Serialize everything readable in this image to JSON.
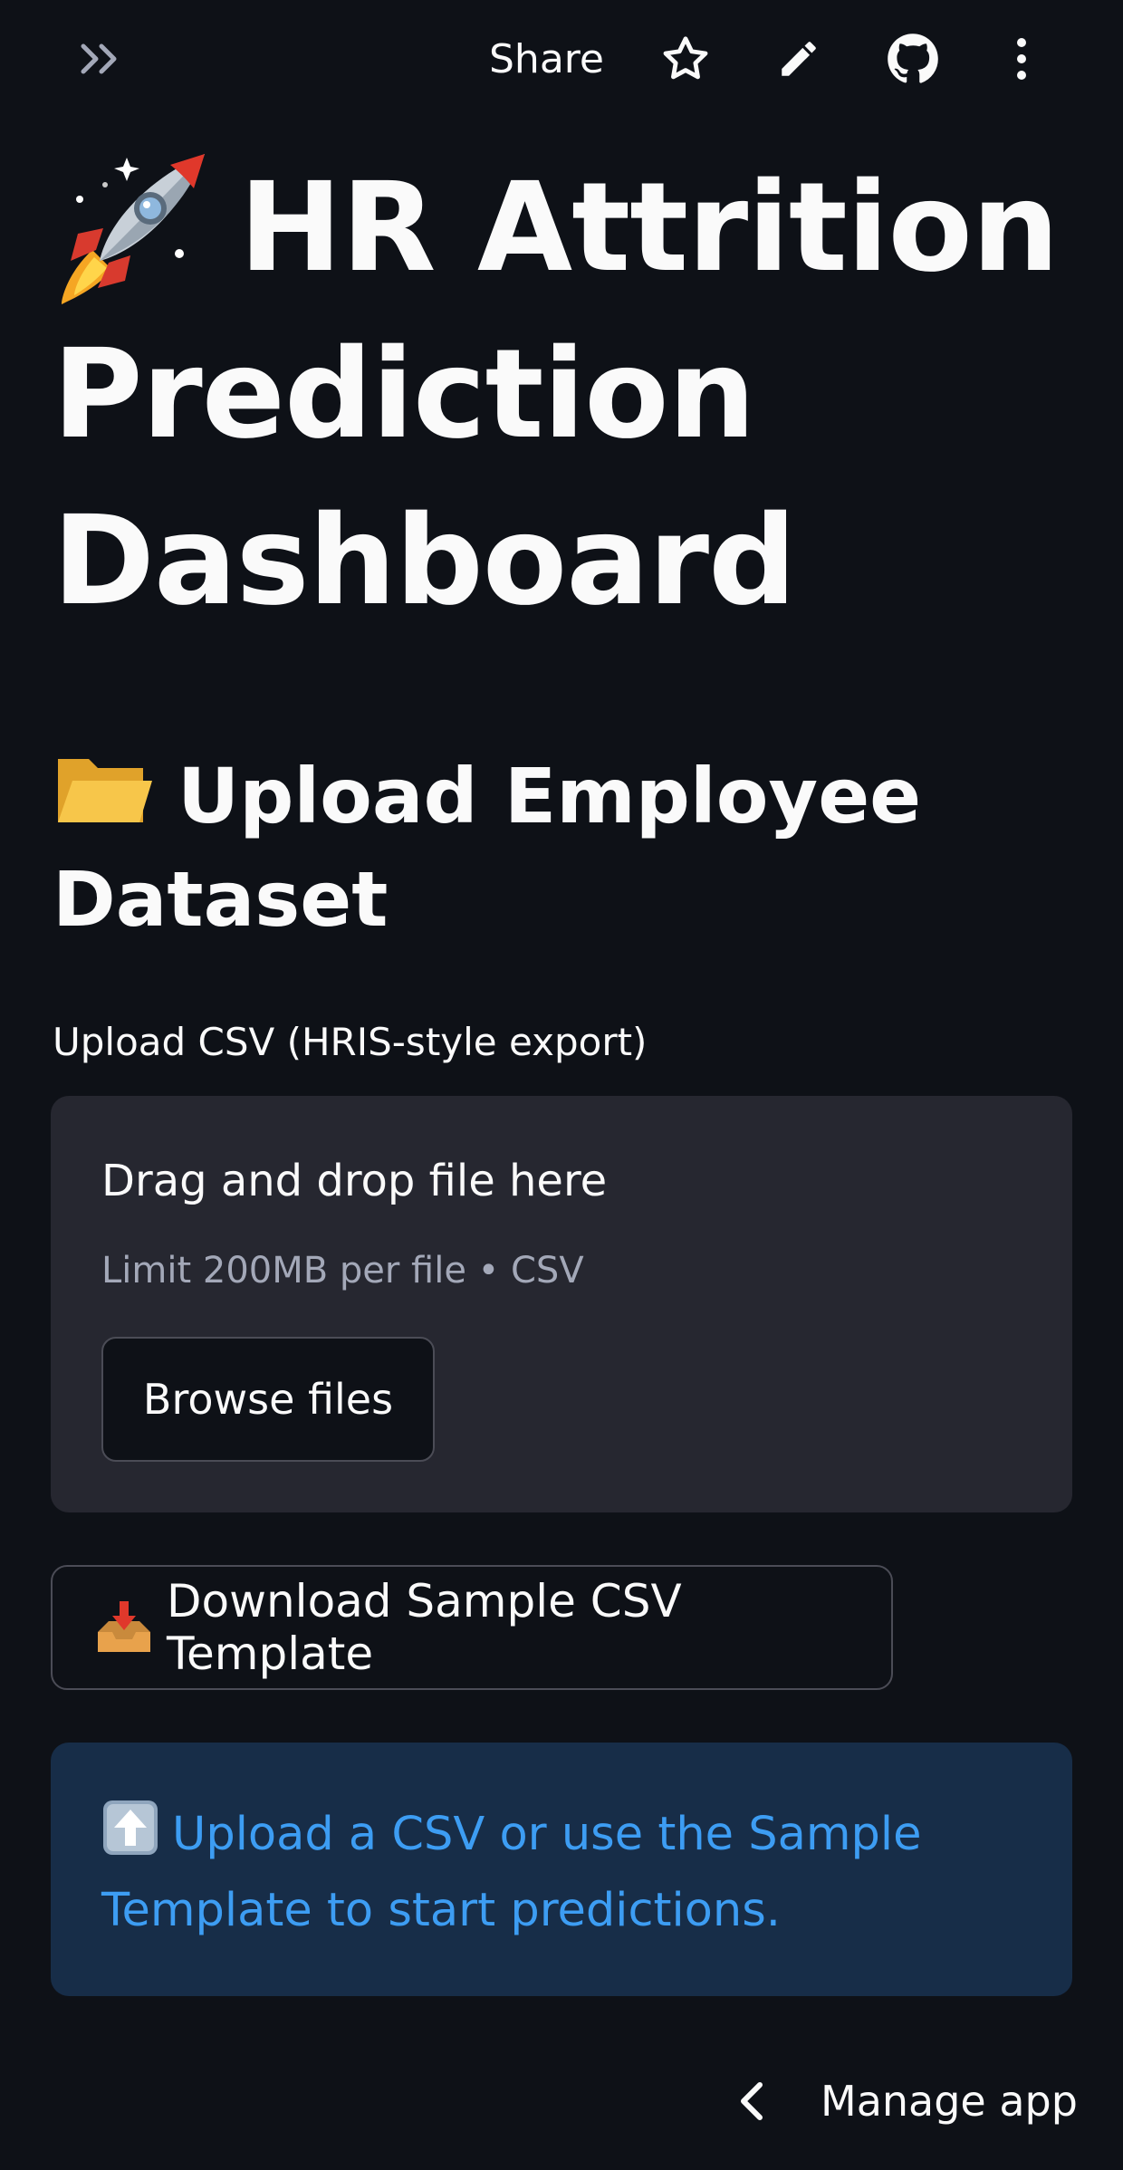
{
  "toolbar": {
    "share_label": "Share",
    "icons": [
      "sidebar-expand-icon",
      "star-icon",
      "pencil-icon",
      "github-icon",
      "more-vertical-icon"
    ]
  },
  "title": {
    "emoji": "rocket-emoji",
    "text": "HR Attrition Prediction Dashboard"
  },
  "section": {
    "emoji": "open-folder-emoji",
    "heading": "Upload Employee Dataset"
  },
  "uploader": {
    "label": "Upload CSV (HRIS-style export)",
    "drop_text": "Drag and drop file here",
    "limit_text": "Limit 200MB per file • CSV",
    "browse_label": "Browse files"
  },
  "download": {
    "emoji": "inbox-tray-emoji",
    "label": "Download Sample CSV Template"
  },
  "info": {
    "emoji": "up-arrow-emoji",
    "text": "Upload a CSV or use the Sample Template to start predictions."
  },
  "footer": {
    "manage_label": "Manage app"
  },
  "colors": {
    "background": "#0e1117",
    "surface": "#262730",
    "info_bg": "#172d48",
    "info_text": "#3d9df3",
    "text": "#fafafa"
  }
}
